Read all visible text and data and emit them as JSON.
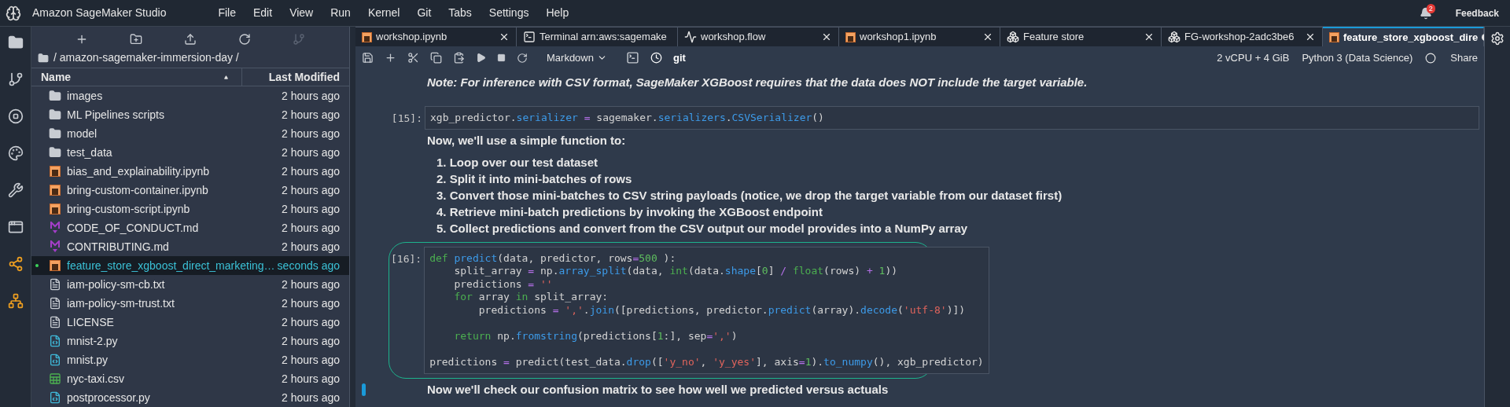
{
  "app": {
    "title": "Amazon SageMaker Studio",
    "menus": [
      "File",
      "Edit",
      "View",
      "Run",
      "Kernel",
      "Git",
      "Tabs",
      "Settings",
      "Help"
    ],
    "notifications": "2",
    "feedback": "Feedback"
  },
  "file_browser": {
    "path": "/ amazon-sagemaker-immersion-day /",
    "columns": [
      "Name",
      "Last Modified"
    ],
    "items": [
      {
        "kind": "folder",
        "name": "images",
        "modified": "2 hours ago",
        "selected": false,
        "open": false
      },
      {
        "kind": "folder",
        "name": "ML Pipelines scripts",
        "modified": "2 hours ago",
        "selected": false,
        "open": false
      },
      {
        "kind": "folder",
        "name": "model",
        "modified": "2 hours ago",
        "selected": false,
        "open": false
      },
      {
        "kind": "folder",
        "name": "test_data",
        "modified": "2 hours ago",
        "selected": false,
        "open": false
      },
      {
        "kind": "notebook",
        "name": "bias_and_explainability.ipynb",
        "modified": "2 hours ago",
        "selected": false,
        "open": false
      },
      {
        "kind": "notebook",
        "name": "bring-custom-container.ipynb",
        "modified": "2 hours ago",
        "selected": false,
        "open": false
      },
      {
        "kind": "notebook",
        "name": "bring-custom-script.ipynb",
        "modified": "2 hours ago",
        "selected": false,
        "open": false
      },
      {
        "kind": "markdown",
        "name": "CODE_OF_CONDUCT.md",
        "modified": "2 hours ago",
        "selected": false,
        "open": false
      },
      {
        "kind": "markdown",
        "name": "CONTRIBUTING.md",
        "modified": "2 hours ago",
        "selected": false,
        "open": false
      },
      {
        "kind": "notebook",
        "name": "feature_store_xgboost_direct_marketing…",
        "modified": "seconds ago",
        "selected": true,
        "open": true
      },
      {
        "kind": "text",
        "name": "iam-policy-sm-cb.txt",
        "modified": "2 hours ago",
        "selected": false,
        "open": false
      },
      {
        "kind": "text",
        "name": "iam-policy-sm-trust.txt",
        "modified": "2 hours ago",
        "selected": false,
        "open": false
      },
      {
        "kind": "text",
        "name": "LICENSE",
        "modified": "2 hours ago",
        "selected": false,
        "open": false
      },
      {
        "kind": "python",
        "name": "mnist-2.py",
        "modified": "2 hours ago",
        "selected": false,
        "open": false
      },
      {
        "kind": "python",
        "name": "mnist.py",
        "modified": "2 hours ago",
        "selected": false,
        "open": false
      },
      {
        "kind": "csv",
        "name": "nyc-taxi.csv",
        "modified": "2 hours ago",
        "selected": false,
        "open": false
      },
      {
        "kind": "python",
        "name": "postprocessor.py",
        "modified": "2 hours ago",
        "selected": false,
        "open": false
      }
    ]
  },
  "tabs": [
    {
      "kind": "notebook",
      "label": "workshop.ipynb",
      "selected": false,
      "dirty": false
    },
    {
      "kind": "terminal",
      "label": "Terminal arn:aws:sagemake",
      "selected": false,
      "dirty": false
    },
    {
      "kind": "flow",
      "label": "workshop.flow",
      "selected": false,
      "dirty": false
    },
    {
      "kind": "notebook",
      "label": "workshop1.ipynb",
      "selected": false,
      "dirty": false
    },
    {
      "kind": "featurestore",
      "label": "Feature store",
      "selected": false,
      "dirty": false
    },
    {
      "kind": "featurestore",
      "label": "FG-workshop-2adc3be6",
      "selected": false,
      "dirty": false
    },
    {
      "kind": "notebook",
      "label": "feature_store_xgboost_dire",
      "selected": true,
      "dirty": true
    }
  ],
  "toolbar": {
    "cell_type": "Markdown",
    "git": "git",
    "instance": "2 vCPU + 4 GiB",
    "kernel": "Python 3 (Data Science)",
    "share": "Share"
  },
  "cells": [
    {
      "kind": "note",
      "text": "Note: For inference with CSV format, SageMaker XGBoost requires that the data does NOT include the target variable."
    },
    {
      "kind": "code",
      "prompt": "[15]:",
      "highlighted": false,
      "lines": [
        {
          "kind": "code",
          "tokens": [
            {
              "kind": "plain",
              "text": "xgb_predictor."
            },
            {
              "kind": "attr",
              "text": "serializer"
            },
            {
              "kind": "operator",
              "text": " = "
            },
            {
              "kind": "plain",
              "text": "sagemaker."
            },
            {
              "kind": "attr",
              "text": "serializers"
            },
            {
              "kind": "plain",
              "text": "."
            },
            {
              "kind": "attr",
              "text": "CSVSerializer"
            },
            {
              "kind": "plain",
              "text": "()"
            }
          ]
        }
      ]
    },
    {
      "kind": "text",
      "text": "Now, we'll use a simple function to:"
    },
    {
      "kind": "list",
      "items": [
        {
          "number": "1.",
          "text": "Loop over our test dataset"
        },
        {
          "number": "2.",
          "text": "Split it into mini-batches of rows"
        },
        {
          "number": "3.",
          "text": "Convert those mini-batches to CSV string payloads (notice, we drop the target variable from our dataset first)"
        },
        {
          "number": "4.",
          "text": "Retrieve mini-batch predictions by invoking the XGBoost endpoint"
        },
        {
          "number": "5.",
          "text": "Collect predictions and convert from the CSV output our model provides into a NumPy array"
        }
      ]
    },
    {
      "kind": "code",
      "prompt": "[16]:",
      "highlighted": true,
      "lines": [
        {
          "kind": "code",
          "tokens": [
            {
              "kind": "keyword",
              "text": "def "
            },
            {
              "kind": "attr",
              "text": "predict"
            },
            {
              "kind": "plain",
              "text": "(data, predictor, rows"
            },
            {
              "kind": "operator",
              "text": "="
            },
            {
              "kind": "number",
              "text": "500"
            },
            {
              "kind": "plain",
              "text": " ):"
            }
          ]
        },
        {
          "kind": "code",
          "tokens": [
            {
              "kind": "plain",
              "text": "    split_array"
            },
            {
              "kind": "operator",
              "text": " = "
            },
            {
              "kind": "plain",
              "text": "np."
            },
            {
              "kind": "attr",
              "text": "array_split"
            },
            {
              "kind": "plain",
              "text": "(data, "
            },
            {
              "kind": "keyword",
              "text": "int"
            },
            {
              "kind": "plain",
              "text": "(data."
            },
            {
              "kind": "attr",
              "text": "shape"
            },
            {
              "kind": "plain",
              "text": "["
            },
            {
              "kind": "number",
              "text": "0"
            },
            {
              "kind": "plain",
              "text": "]"
            },
            {
              "kind": "operator",
              "text": " / "
            },
            {
              "kind": "keyword",
              "text": "float"
            },
            {
              "kind": "plain",
              "text": "(rows)"
            },
            {
              "kind": "operator",
              "text": " + "
            },
            {
              "kind": "number",
              "text": "1"
            },
            {
              "kind": "plain",
              "text": "))"
            }
          ]
        },
        {
          "kind": "code",
          "tokens": [
            {
              "kind": "plain",
              "text": "    predictions"
            },
            {
              "kind": "operator",
              "text": " = "
            },
            {
              "kind": "string",
              "text": "''"
            }
          ]
        },
        {
          "kind": "code",
          "tokens": [
            {
              "kind": "keyword",
              "text": "    for"
            },
            {
              "kind": "plain",
              "text": " array "
            },
            {
              "kind": "keyword",
              "text": "in"
            },
            {
              "kind": "plain",
              "text": " split_array:"
            }
          ]
        },
        {
          "kind": "code",
          "tokens": [
            {
              "kind": "plain",
              "text": "        predictions"
            },
            {
              "kind": "operator",
              "text": " = "
            },
            {
              "kind": "string",
              "text": "','"
            },
            {
              "kind": "plain",
              "text": "."
            },
            {
              "kind": "attr",
              "text": "join"
            },
            {
              "kind": "plain",
              "text": "([predictions, predictor."
            },
            {
              "kind": "attr",
              "text": "predict"
            },
            {
              "kind": "plain",
              "text": "(array)."
            },
            {
              "kind": "attr",
              "text": "decode"
            },
            {
              "kind": "plain",
              "text": "("
            },
            {
              "kind": "string",
              "text": "'utf-8'"
            },
            {
              "kind": "plain",
              "text": ")])"
            }
          ]
        },
        {
          "kind": "blank"
        },
        {
          "kind": "code",
          "tokens": [
            {
              "kind": "keyword",
              "text": "    return"
            },
            {
              "kind": "plain",
              "text": " np."
            },
            {
              "kind": "attr",
              "text": "fromstring"
            },
            {
              "kind": "plain",
              "text": "(predictions["
            },
            {
              "kind": "number",
              "text": "1"
            },
            {
              "kind": "plain",
              "text": ":], sep"
            },
            {
              "kind": "operator",
              "text": "="
            },
            {
              "kind": "string",
              "text": "','"
            },
            {
              "kind": "plain",
              "text": ")"
            }
          ]
        },
        {
          "kind": "blank"
        },
        {
          "kind": "code",
          "tokens": [
            {
              "kind": "plain",
              "text": "predictions"
            },
            {
              "kind": "operator",
              "text": " = "
            },
            {
              "kind": "plain",
              "text": "predict(test_data."
            },
            {
              "kind": "attr",
              "text": "drop"
            },
            {
              "kind": "plain",
              "text": "(["
            },
            {
              "kind": "string",
              "text": "'y_no'"
            },
            {
              "kind": "plain",
              "text": ", "
            },
            {
              "kind": "string",
              "text": "'y_yes'"
            },
            {
              "kind": "plain",
              "text": "], axis"
            },
            {
              "kind": "operator",
              "text": "="
            },
            {
              "kind": "number",
              "text": "1"
            },
            {
              "kind": "plain",
              "text": ")."
            },
            {
              "kind": "attr",
              "text": "to_numpy"
            },
            {
              "kind": "plain",
              "text": "(), xgb_predictor)"
            }
          ]
        }
      ]
    },
    {
      "kind": "text",
      "active": true,
      "text": "Now we'll check our confusion matrix to see how well we predicted versus actuals"
    }
  ]
}
